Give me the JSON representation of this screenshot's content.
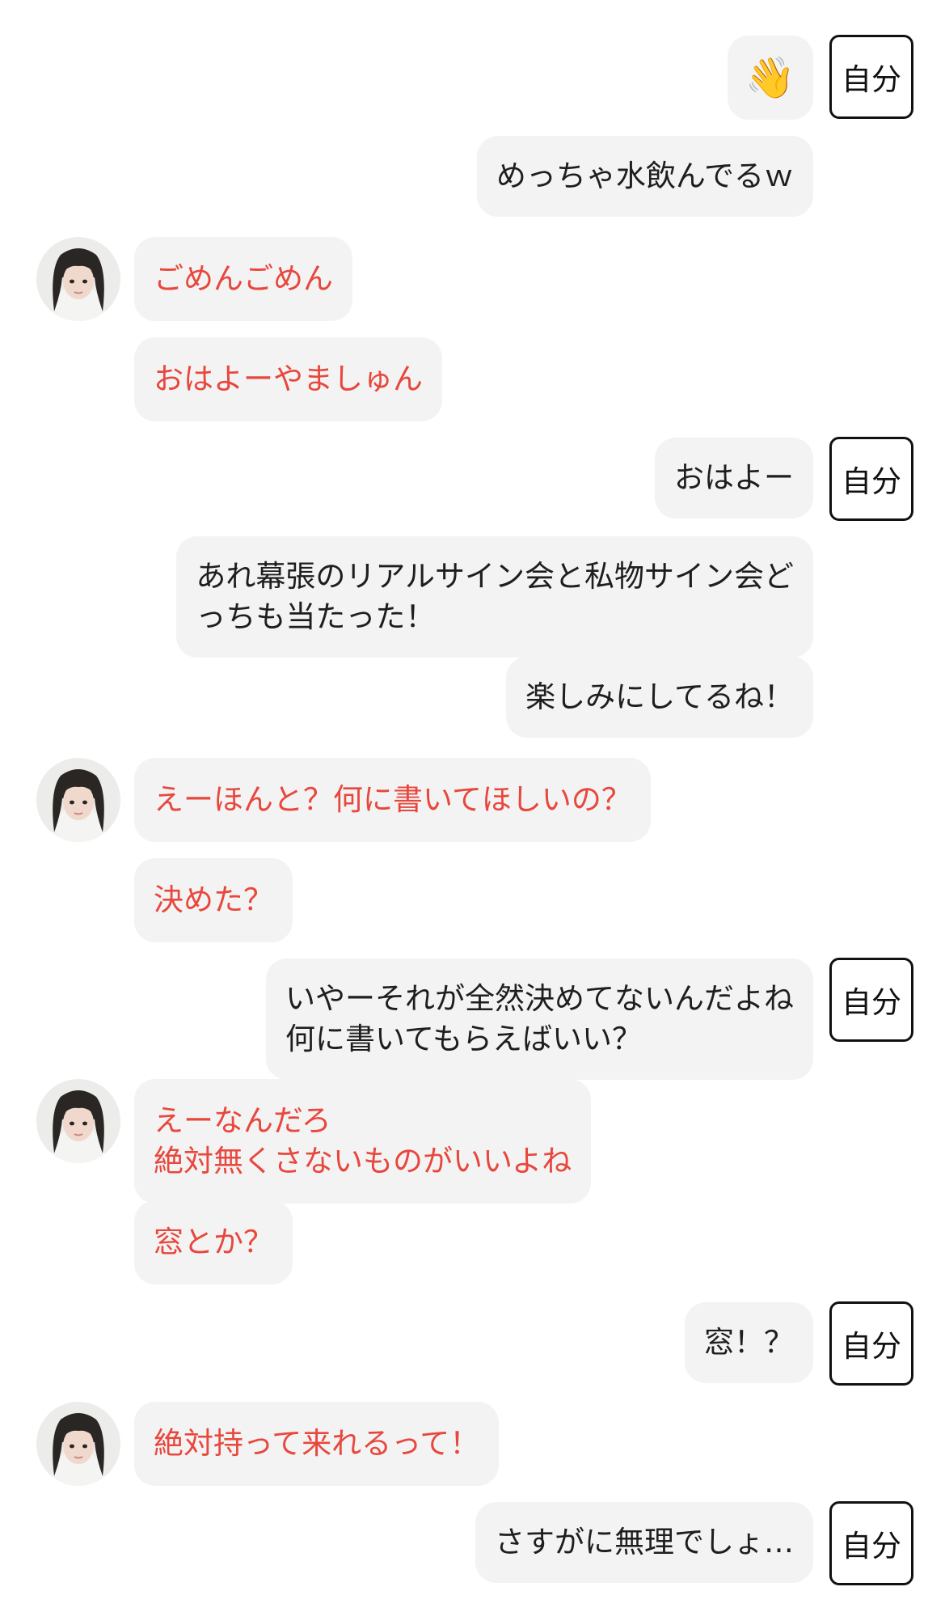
{
  "self_label": "自分",
  "messages": [
    {
      "from": "self",
      "text": "👋",
      "tag": true
    },
    {
      "from": "self",
      "text": "めっちゃ水飲んでるｗ",
      "tag": false
    },
    {
      "from": "other",
      "text": "ごめんごめん",
      "avatar": true
    },
    {
      "from": "other",
      "text": "おはよーやましゅん",
      "avatar": false
    },
    {
      "from": "self",
      "text": "おはよー",
      "tag": true
    },
    {
      "from": "self",
      "text": "あれ幕張のリアルサイン会と私物サイン会ど\nっちも当たった！",
      "tag": false
    },
    {
      "from": "self",
      "text": "楽しみにしてるね！",
      "tag": false
    },
    {
      "from": "other",
      "text": "えーほんと？何に書いてほしいの？",
      "avatar": true
    },
    {
      "from": "other",
      "text": "決めた？",
      "avatar": false
    },
    {
      "from": "self",
      "text": "いやーそれが全然決めてないんだよね\n何に書いてもらえばいい？",
      "tag": true
    },
    {
      "from": "other",
      "text": "えーなんだろ\n絶対無くさないものがいいよね",
      "avatar": true
    },
    {
      "from": "other",
      "text": "窓とか？",
      "avatar": false
    },
    {
      "from": "self",
      "text": "窓！？",
      "tag": true
    },
    {
      "from": "other",
      "text": "絶対持って来れるって！",
      "avatar": true
    },
    {
      "from": "self",
      "text": "さすがに無理でしょ…",
      "tag": true
    }
  ]
}
